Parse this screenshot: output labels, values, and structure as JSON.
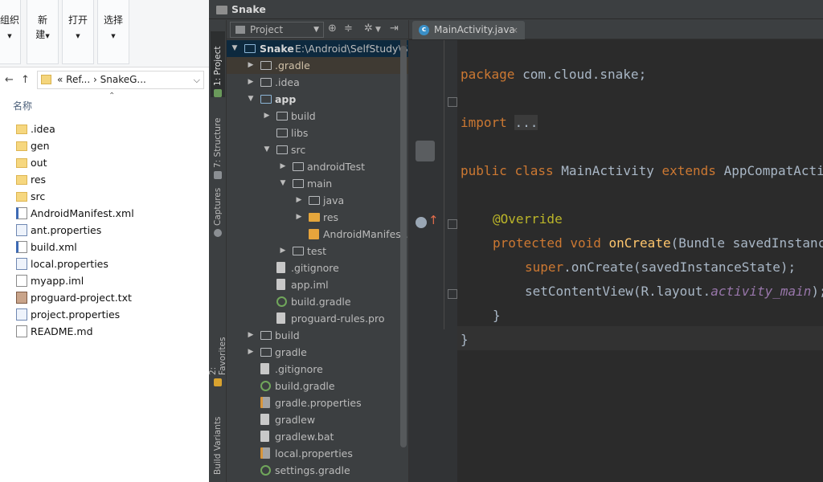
{
  "explorer": {
    "ribbon": [
      {
        "label1": "组织",
        "label2": "",
        "arrow": true
      },
      {
        "label1": "新",
        "label2": "建",
        "arrow": true
      },
      {
        "label1": "打开",
        "label2": "",
        "arrow": true
      },
      {
        "label1": "选择",
        "label2": "",
        "arrow": true
      }
    ],
    "nav": {
      "back": "←",
      "up": "↑"
    },
    "address": {
      "prefix": "«",
      "parts": [
        "Ref...",
        "SnakeG..."
      ],
      "separator": "›"
    },
    "column_header": "名称",
    "files": [
      {
        "name": ".idea",
        "type": "folder"
      },
      {
        "name": "gen",
        "type": "folder"
      },
      {
        "name": "out",
        "type": "folder"
      },
      {
        "name": "res",
        "type": "folder"
      },
      {
        "name": "src",
        "type": "folder"
      },
      {
        "name": "AndroidManifest.xml",
        "type": "xml"
      },
      {
        "name": "ant.properties",
        "type": "properties"
      },
      {
        "name": "build.xml",
        "type": "xml"
      },
      {
        "name": "local.properties",
        "type": "properties"
      },
      {
        "name": "myapp.iml",
        "type": "file"
      },
      {
        "name": "proguard-project.txt",
        "type": "txt"
      },
      {
        "name": "project.properties",
        "type": "properties"
      },
      {
        "name": "README.md",
        "type": "file"
      }
    ]
  },
  "studio": {
    "title": "Snake",
    "side_tabs": {
      "project": "1: Project",
      "structure": "7: Structure",
      "captures": "Captures",
      "favorites": "2: Favorites",
      "build_variants": "Build Variants"
    },
    "project_view": "Project",
    "tree_root": {
      "name": "Snake",
      "path": "E:\\Android\\SelfStudy\\Snake"
    },
    "tree": [
      {
        "label": ".gradle",
        "indent": 1,
        "icon": "folder",
        "arrow": "right",
        "hl": true
      },
      {
        "label": ".idea",
        "indent": 1,
        "icon": "folder",
        "arrow": "right"
      },
      {
        "label": "app",
        "indent": 1,
        "icon": "module",
        "arrow": "down",
        "bold": true
      },
      {
        "label": "build",
        "indent": 2,
        "icon": "folder",
        "arrow": "right"
      },
      {
        "label": "libs",
        "indent": 2,
        "icon": "folder",
        "arrow": ""
      },
      {
        "label": "src",
        "indent": 2,
        "icon": "folder",
        "arrow": "down"
      },
      {
        "label": "androidTest",
        "indent": 3,
        "icon": "folder",
        "arrow": "right"
      },
      {
        "label": "main",
        "indent": 3,
        "icon": "folder",
        "arrow": "down"
      },
      {
        "label": "java",
        "indent": 4,
        "icon": "folder",
        "arrow": "right"
      },
      {
        "label": "res",
        "indent": 4,
        "icon": "res",
        "arrow": "right"
      },
      {
        "label": "AndroidManifest.xml",
        "indent": 4,
        "icon": "xml",
        "arrow": ""
      },
      {
        "label": "test",
        "indent": 3,
        "icon": "folder",
        "arrow": "right"
      },
      {
        "label": ".gitignore",
        "indent": 2,
        "icon": "file",
        "arrow": ""
      },
      {
        "label": "app.iml",
        "indent": 2,
        "icon": "file",
        "arrow": ""
      },
      {
        "label": "build.gradle",
        "indent": 2,
        "icon": "gradle",
        "arrow": ""
      },
      {
        "label": "proguard-rules.pro",
        "indent": 2,
        "icon": "file",
        "arrow": ""
      },
      {
        "label": "build",
        "indent": 1,
        "icon": "folder",
        "arrow": "right"
      },
      {
        "label": "gradle",
        "indent": 1,
        "icon": "folder",
        "arrow": "right"
      },
      {
        "label": ".gitignore",
        "indent": 1,
        "icon": "file",
        "arrow": ""
      },
      {
        "label": "build.gradle",
        "indent": 1,
        "icon": "gradle",
        "arrow": ""
      },
      {
        "label": "gradle.properties",
        "indent": 1,
        "icon": "properties",
        "arrow": ""
      },
      {
        "label": "gradlew",
        "indent": 1,
        "icon": "file",
        "arrow": ""
      },
      {
        "label": "gradlew.bat",
        "indent": 1,
        "icon": "file",
        "arrow": ""
      },
      {
        "label": "local.properties",
        "indent": 1,
        "icon": "properties",
        "arrow": ""
      },
      {
        "label": "settings.gradle",
        "indent": 1,
        "icon": "gradle",
        "arrow": ""
      }
    ],
    "editor_tab": "MainActivity.java",
    "code": {
      "l1_kw": "package",
      "l1_rest": " com.cloud.snake;",
      "l2_kw": "import",
      "l2_fold": "...",
      "l3_kw1": "public",
      "l3_kw2": "class",
      "l3_name": "MainActivity",
      "l3_kw3": "extends",
      "l3_rest": "AppCompatActivity {",
      "l4_ann": "@Override",
      "l5_kw1": "protected",
      "l5_kw2": "void",
      "l5_fn": "onCreate",
      "l5_rest": "(Bundle savedInstanceState) {",
      "l6_kw": "super",
      "l6_rest": ".onCreate(savedInstanceState);",
      "l7_pre": "setContentView(R.layout.",
      "l7_field": "activity_main",
      "l7_post": ");",
      "l8": "}",
      "l9": "}"
    },
    "colors": {
      "keyword": "#cc7832",
      "annotation": "#bbb529",
      "method": "#ffc66d",
      "field": "#9876aa",
      "text": "#a9b7c6",
      "background": "#2b2b2b"
    }
  }
}
